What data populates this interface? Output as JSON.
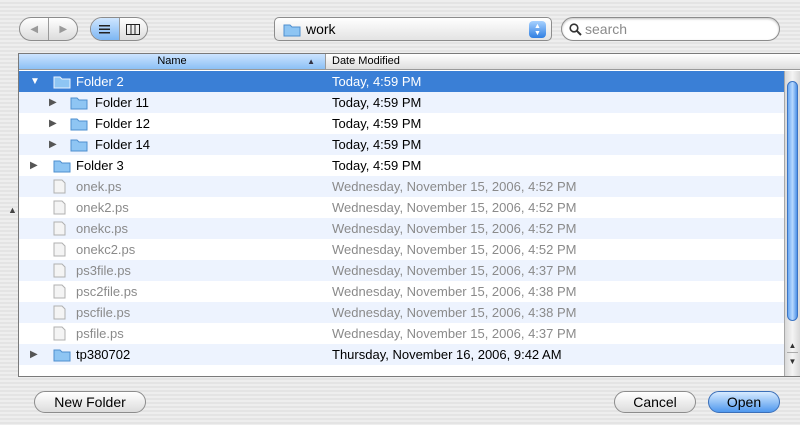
{
  "toolbar": {
    "back_icon": "left-arrow-icon",
    "forward_icon": "right-arrow-icon",
    "list_view_icon": "list-view-icon",
    "column_view_icon": "column-view-icon",
    "location": "work",
    "search_placeholder": "search"
  },
  "columns": {
    "name": "Name",
    "date": "Date Modified"
  },
  "rows": [
    {
      "name": "Folder 2",
      "date": "Today, 4:59 PM"
    },
    {
      "name": "Folder 11",
      "date": "Today, 4:59 PM"
    },
    {
      "name": "Folder 12",
      "date": "Today, 4:59 PM"
    },
    {
      "name": "Folder 14",
      "date": "Today, 4:59 PM"
    },
    {
      "name": "Folder 3",
      "date": "Today, 4:59 PM"
    },
    {
      "name": "onek.ps",
      "date": "Wednesday, November 15, 2006, 4:52 PM"
    },
    {
      "name": "onek2.ps",
      "date": "Wednesday, November 15, 2006, 4:52 PM"
    },
    {
      "name": "onekc.ps",
      "date": "Wednesday, November 15, 2006, 4:52 PM"
    },
    {
      "name": "onekc2.ps",
      "date": "Wednesday, November 15, 2006, 4:52 PM"
    },
    {
      "name": "ps3file.ps",
      "date": "Wednesday, November 15, 2006, 4:37 PM"
    },
    {
      "name": "psc2file.ps",
      "date": "Wednesday, November 15, 2006, 4:38 PM"
    },
    {
      "name": "pscfile.ps",
      "date": "Wednesday, November 15, 2006, 4:38 PM"
    },
    {
      "name": "psfile.ps",
      "date": "Wednesday, November 15, 2006, 4:37 PM"
    },
    {
      "name": "tp380702",
      "date": "Thursday, November 16, 2006, 9:42 AM"
    }
  ],
  "buttons": {
    "new_folder": "New Folder",
    "cancel": "Cancel",
    "open": "Open"
  },
  "colors": {
    "selection": "#3a7fd6",
    "folder": "#8ec5f3",
    "default_button": "#4f98ee"
  }
}
